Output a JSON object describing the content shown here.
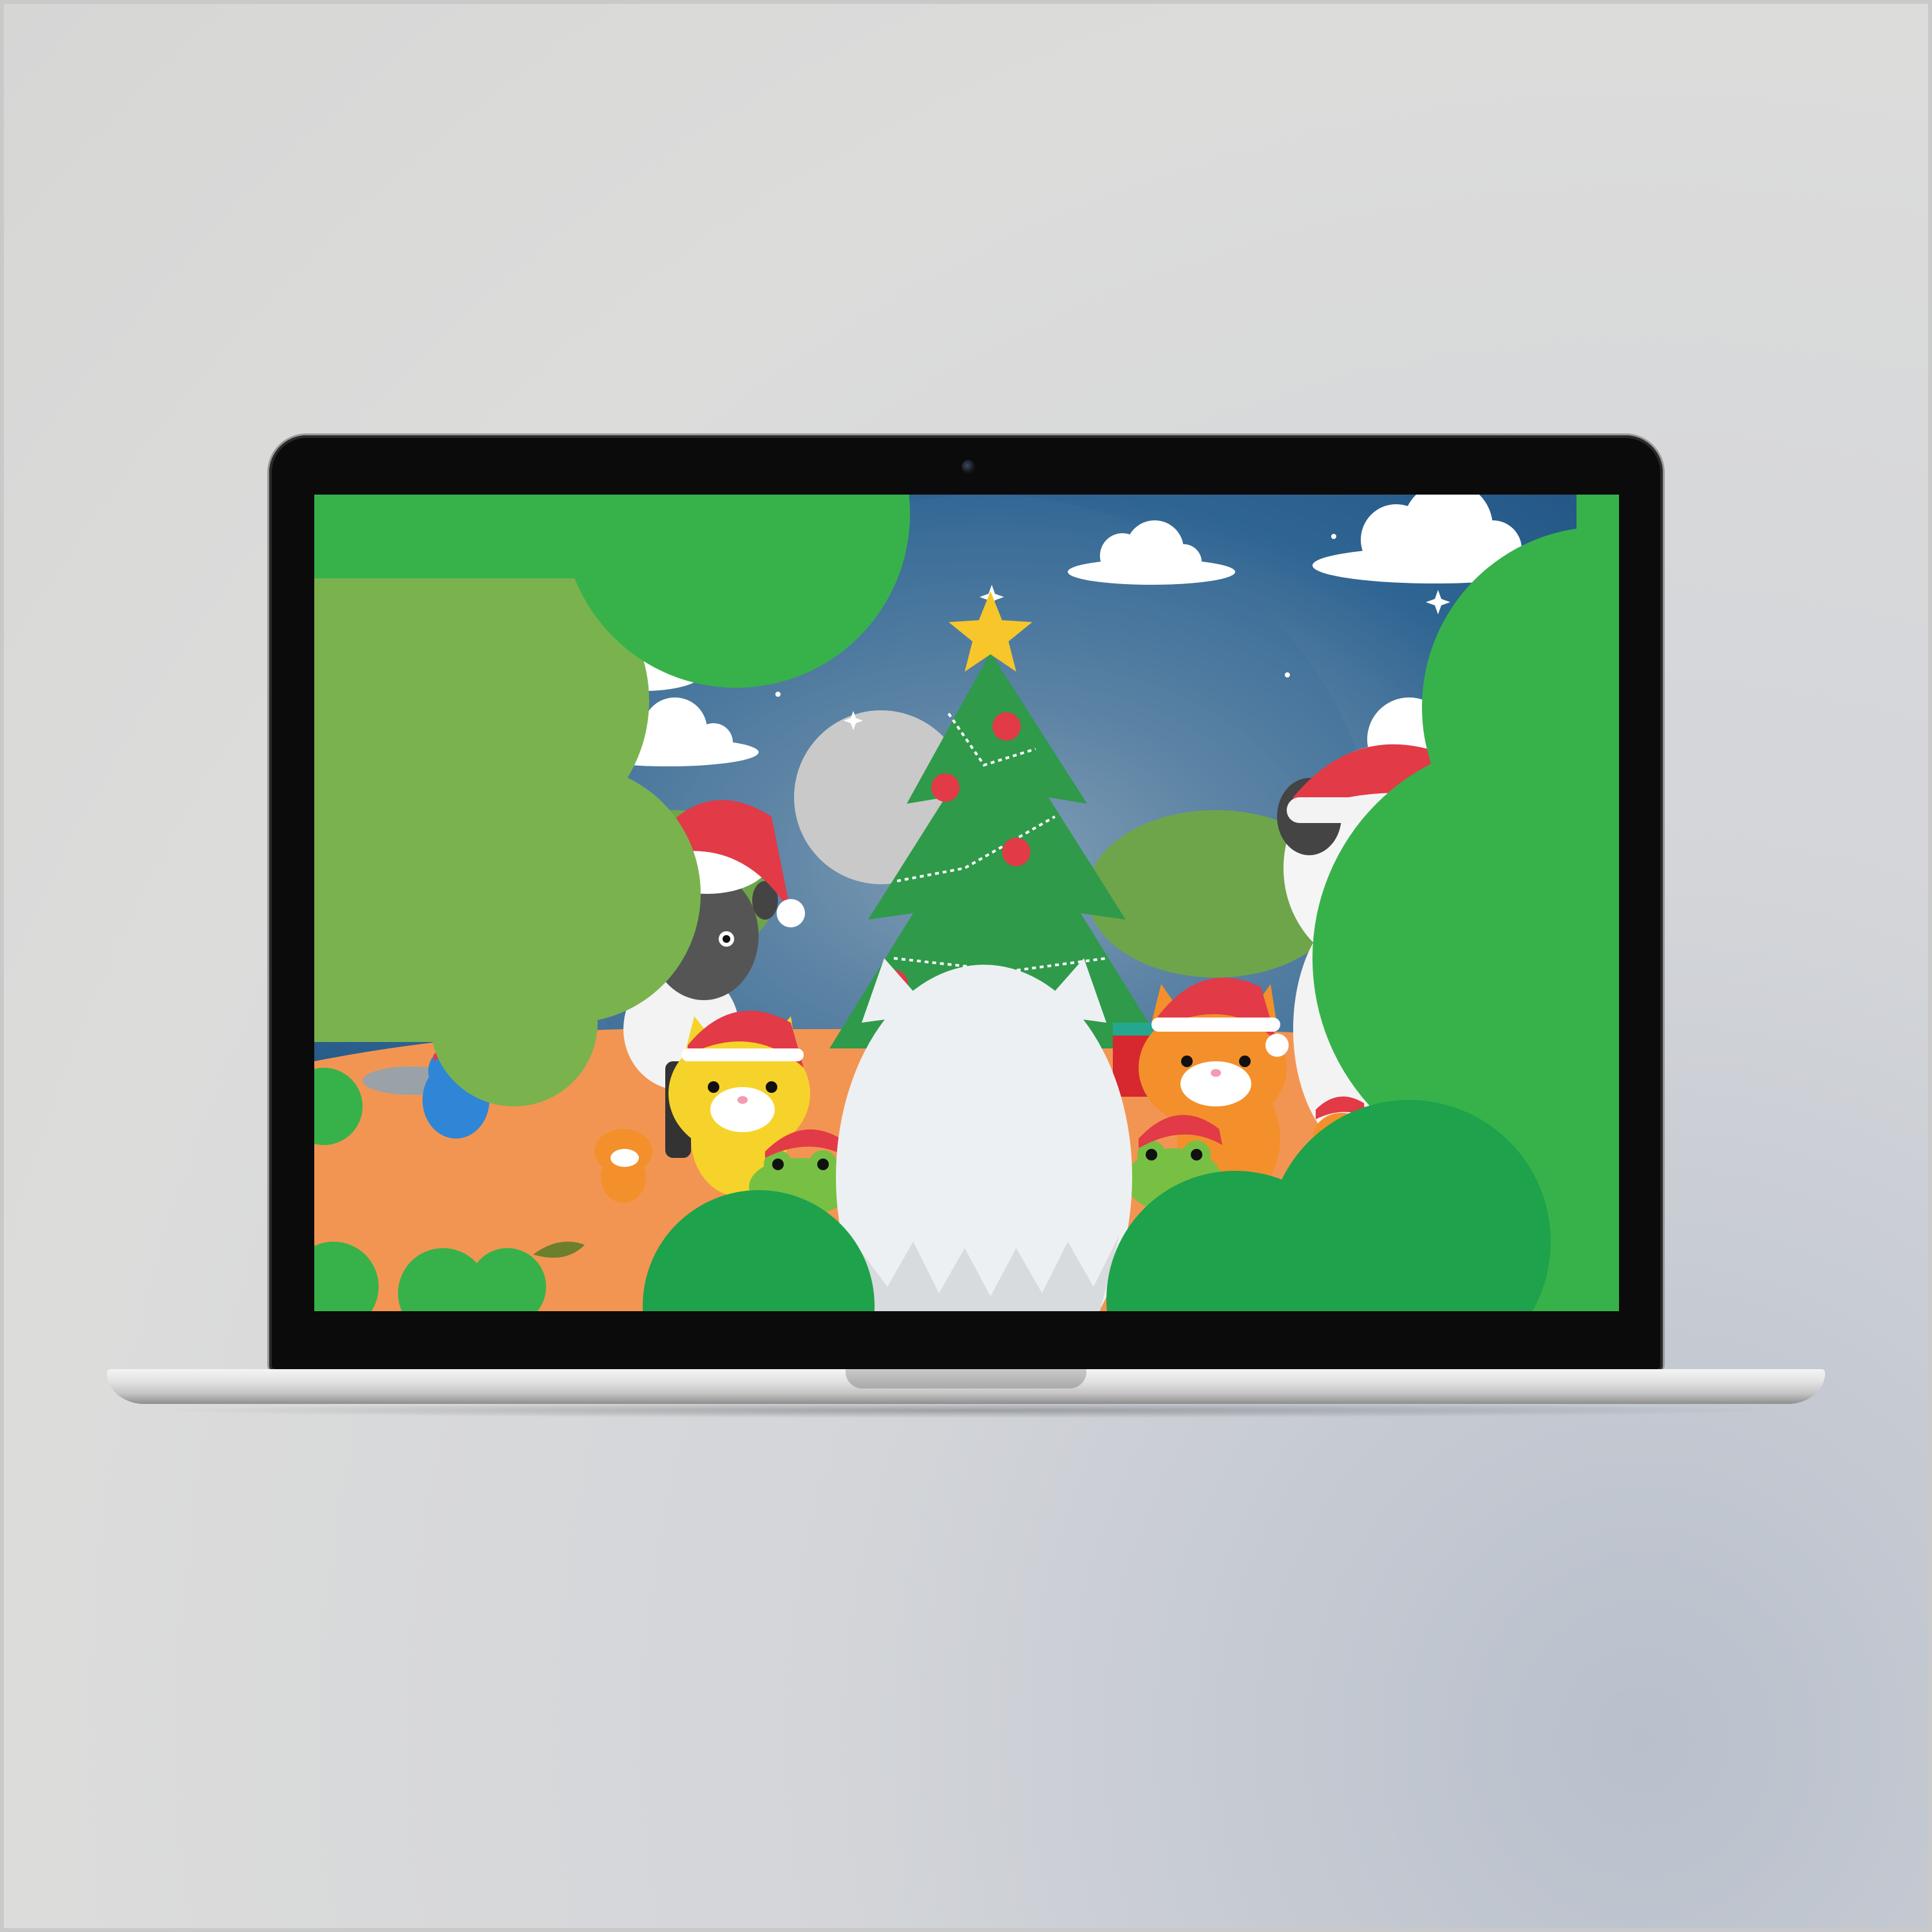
{
  "scene": {
    "name": "christmas-farm-animals-scene",
    "colors": {
      "sky_top": "#1f5a8c",
      "sky_glow": "#9fb4c2",
      "foreground_bush": "#37b24a",
      "left_tree": "#7ab34e",
      "ground": "#f39552",
      "santa_hat_red": "#e23a47",
      "star_yellow": "#f6c62b",
      "tree_green": "#2f9a4a"
    },
    "characters": [
      {
        "id": "blue-bird",
        "icon": "bird-icon"
      },
      {
        "id": "small-orange-cat-left",
        "icon": "cat-icon"
      },
      {
        "id": "yellow-cat",
        "icon": "cat-icon"
      },
      {
        "id": "green-frog-left",
        "icon": "frog-icon"
      },
      {
        "id": "black-sheep",
        "icon": "sheep-icon"
      },
      {
        "id": "white-cat-back",
        "icon": "cat-icon"
      },
      {
        "id": "orange-cat",
        "icon": "cat-icon"
      },
      {
        "id": "green-frog-right",
        "icon": "frog-icon"
      },
      {
        "id": "cow",
        "icon": "cow-icon"
      },
      {
        "id": "small-orange-cat-right",
        "icon": "cat-icon"
      }
    ],
    "decorations": [
      "christmas-tree-icon",
      "star-icon",
      "cloud-icon",
      "moon-icon",
      "gift-icon"
    ]
  }
}
